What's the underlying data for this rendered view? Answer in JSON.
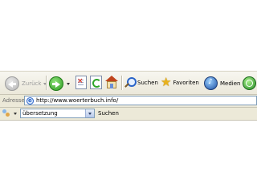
{
  "toolbar": {
    "back_label": "Zurück",
    "search_label": "Suchen",
    "favorites_label": "Favoriten",
    "media_label": "Medien"
  },
  "address": {
    "label": "Adresse",
    "url": "http://www.woerterbuch.info/"
  },
  "searchbar": {
    "selected": "übersetzung",
    "go_label": "Suchen"
  },
  "icons": {
    "back": "back-arrow-icon",
    "forward": "forward-arrow-icon",
    "stop": "stop-icon",
    "refresh": "refresh-icon",
    "home": "home-icon",
    "search": "magnifier-icon",
    "favorites": "star-icon",
    "media": "media-icon",
    "history": "history-icon",
    "page": "ie-page-icon"
  }
}
